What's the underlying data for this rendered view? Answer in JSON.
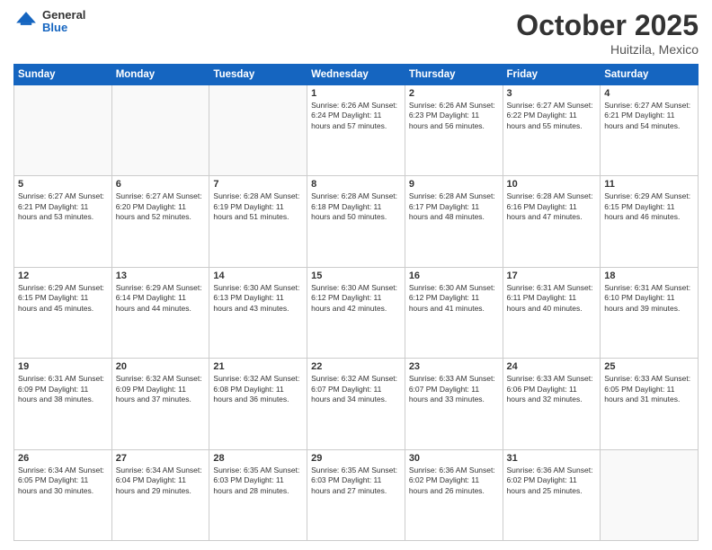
{
  "header": {
    "logo_general": "General",
    "logo_blue": "Blue",
    "month": "October 2025",
    "location": "Huitzila, Mexico"
  },
  "days_of_week": [
    "Sunday",
    "Monday",
    "Tuesday",
    "Wednesday",
    "Thursday",
    "Friday",
    "Saturday"
  ],
  "weeks": [
    [
      {
        "day": "",
        "detail": ""
      },
      {
        "day": "",
        "detail": ""
      },
      {
        "day": "",
        "detail": ""
      },
      {
        "day": "1",
        "detail": "Sunrise: 6:26 AM\nSunset: 6:24 PM\nDaylight: 11 hours\nand 57 minutes."
      },
      {
        "day": "2",
        "detail": "Sunrise: 6:26 AM\nSunset: 6:23 PM\nDaylight: 11 hours\nand 56 minutes."
      },
      {
        "day": "3",
        "detail": "Sunrise: 6:27 AM\nSunset: 6:22 PM\nDaylight: 11 hours\nand 55 minutes."
      },
      {
        "day": "4",
        "detail": "Sunrise: 6:27 AM\nSunset: 6:21 PM\nDaylight: 11 hours\nand 54 minutes."
      }
    ],
    [
      {
        "day": "5",
        "detail": "Sunrise: 6:27 AM\nSunset: 6:21 PM\nDaylight: 11 hours\nand 53 minutes."
      },
      {
        "day": "6",
        "detail": "Sunrise: 6:27 AM\nSunset: 6:20 PM\nDaylight: 11 hours\nand 52 minutes."
      },
      {
        "day": "7",
        "detail": "Sunrise: 6:28 AM\nSunset: 6:19 PM\nDaylight: 11 hours\nand 51 minutes."
      },
      {
        "day": "8",
        "detail": "Sunrise: 6:28 AM\nSunset: 6:18 PM\nDaylight: 11 hours\nand 50 minutes."
      },
      {
        "day": "9",
        "detail": "Sunrise: 6:28 AM\nSunset: 6:17 PM\nDaylight: 11 hours\nand 48 minutes."
      },
      {
        "day": "10",
        "detail": "Sunrise: 6:28 AM\nSunset: 6:16 PM\nDaylight: 11 hours\nand 47 minutes."
      },
      {
        "day": "11",
        "detail": "Sunrise: 6:29 AM\nSunset: 6:15 PM\nDaylight: 11 hours\nand 46 minutes."
      }
    ],
    [
      {
        "day": "12",
        "detail": "Sunrise: 6:29 AM\nSunset: 6:15 PM\nDaylight: 11 hours\nand 45 minutes."
      },
      {
        "day": "13",
        "detail": "Sunrise: 6:29 AM\nSunset: 6:14 PM\nDaylight: 11 hours\nand 44 minutes."
      },
      {
        "day": "14",
        "detail": "Sunrise: 6:30 AM\nSunset: 6:13 PM\nDaylight: 11 hours\nand 43 minutes."
      },
      {
        "day": "15",
        "detail": "Sunrise: 6:30 AM\nSunset: 6:12 PM\nDaylight: 11 hours\nand 42 minutes."
      },
      {
        "day": "16",
        "detail": "Sunrise: 6:30 AM\nSunset: 6:12 PM\nDaylight: 11 hours\nand 41 minutes."
      },
      {
        "day": "17",
        "detail": "Sunrise: 6:31 AM\nSunset: 6:11 PM\nDaylight: 11 hours\nand 40 minutes."
      },
      {
        "day": "18",
        "detail": "Sunrise: 6:31 AM\nSunset: 6:10 PM\nDaylight: 11 hours\nand 39 minutes."
      }
    ],
    [
      {
        "day": "19",
        "detail": "Sunrise: 6:31 AM\nSunset: 6:09 PM\nDaylight: 11 hours\nand 38 minutes."
      },
      {
        "day": "20",
        "detail": "Sunrise: 6:32 AM\nSunset: 6:09 PM\nDaylight: 11 hours\nand 37 minutes."
      },
      {
        "day": "21",
        "detail": "Sunrise: 6:32 AM\nSunset: 6:08 PM\nDaylight: 11 hours\nand 36 minutes."
      },
      {
        "day": "22",
        "detail": "Sunrise: 6:32 AM\nSunset: 6:07 PM\nDaylight: 11 hours\nand 34 minutes."
      },
      {
        "day": "23",
        "detail": "Sunrise: 6:33 AM\nSunset: 6:07 PM\nDaylight: 11 hours\nand 33 minutes."
      },
      {
        "day": "24",
        "detail": "Sunrise: 6:33 AM\nSunset: 6:06 PM\nDaylight: 11 hours\nand 32 minutes."
      },
      {
        "day": "25",
        "detail": "Sunrise: 6:33 AM\nSunset: 6:05 PM\nDaylight: 11 hours\nand 31 minutes."
      }
    ],
    [
      {
        "day": "26",
        "detail": "Sunrise: 6:34 AM\nSunset: 6:05 PM\nDaylight: 11 hours\nand 30 minutes."
      },
      {
        "day": "27",
        "detail": "Sunrise: 6:34 AM\nSunset: 6:04 PM\nDaylight: 11 hours\nand 29 minutes."
      },
      {
        "day": "28",
        "detail": "Sunrise: 6:35 AM\nSunset: 6:03 PM\nDaylight: 11 hours\nand 28 minutes."
      },
      {
        "day": "29",
        "detail": "Sunrise: 6:35 AM\nSunset: 6:03 PM\nDaylight: 11 hours\nand 27 minutes."
      },
      {
        "day": "30",
        "detail": "Sunrise: 6:36 AM\nSunset: 6:02 PM\nDaylight: 11 hours\nand 26 minutes."
      },
      {
        "day": "31",
        "detail": "Sunrise: 6:36 AM\nSunset: 6:02 PM\nDaylight: 11 hours\nand 25 minutes."
      },
      {
        "day": "",
        "detail": ""
      }
    ]
  ]
}
